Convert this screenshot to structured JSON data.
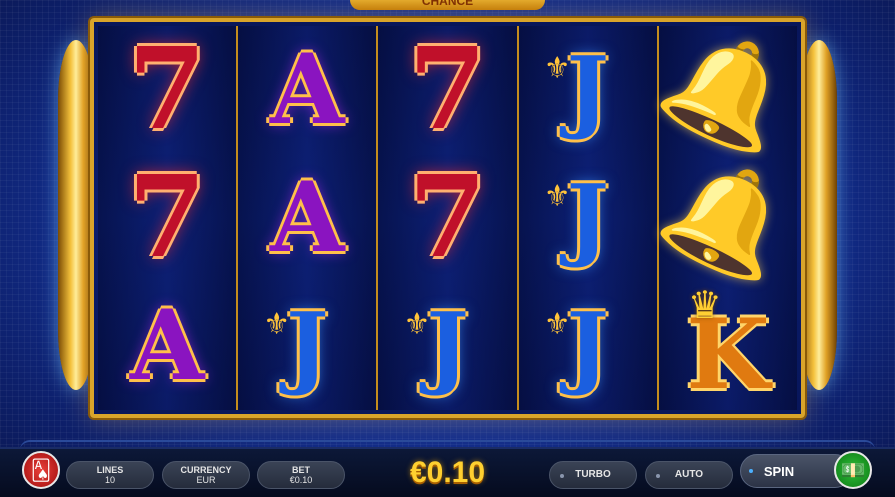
{
  "game": {
    "logo_text": "CHANCE"
  },
  "reels": [
    [
      {
        "symbol": "seven",
        "glyph": "7"
      },
      {
        "symbol": "seven",
        "glyph": "7"
      },
      {
        "symbol": "ace",
        "glyph": "A"
      }
    ],
    [
      {
        "symbol": "ace",
        "glyph": "A"
      },
      {
        "symbol": "ace",
        "glyph": "A"
      },
      {
        "symbol": "jack",
        "glyph": "J"
      }
    ],
    [
      {
        "symbol": "seven",
        "glyph": "7"
      },
      {
        "symbol": "seven",
        "glyph": "7"
      },
      {
        "symbol": "jack",
        "glyph": "J"
      }
    ],
    [
      {
        "symbol": "jack",
        "glyph": "J"
      },
      {
        "symbol": "jack",
        "glyph": "J"
      },
      {
        "symbol": "jack",
        "glyph": "J"
      }
    ],
    [
      {
        "symbol": "bell",
        "glyph": "🔔"
      },
      {
        "symbol": "bell",
        "glyph": "🔔"
      },
      {
        "symbol": "king",
        "glyph": "K"
      }
    ]
  ],
  "controls": {
    "info_icon": "cards-icon",
    "lines": {
      "label": "LINES",
      "value": "10"
    },
    "currency": {
      "label": "CURRENCY",
      "value": "EUR"
    },
    "bet": {
      "label": "BET",
      "value": "€0.10"
    },
    "win_display": "€0.10",
    "turbo_label": "TURBO",
    "auto_label": "AUTO",
    "spin_label": "SPIN",
    "spin_icon": "cash-icon"
  },
  "colors": {
    "frame_gold": "#d9a42a",
    "background_blue": "#1637a3",
    "win_gold": "#ffd030",
    "spin_green": "#1ea02a",
    "info_red": "#c0201c"
  }
}
